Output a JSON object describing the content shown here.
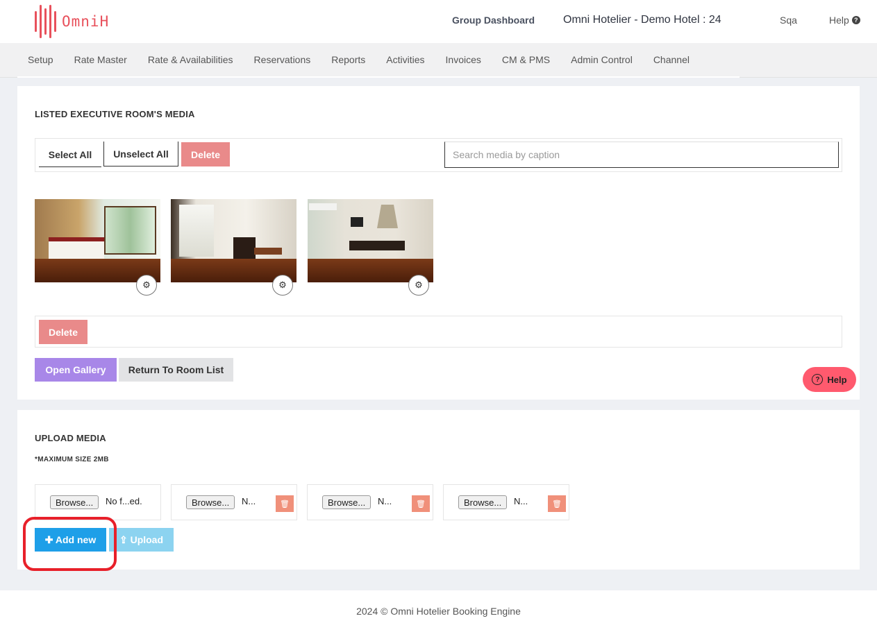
{
  "header": {
    "logo_text": "OmniH",
    "group_dashboard": "Group Dashboard",
    "hotel_name": "Omni Hotelier - Demo Hotel : 24",
    "user": "Sqa",
    "help": "Help"
  },
  "nav": {
    "items": [
      "Setup",
      "Rate Master",
      "Rate & Availabilities",
      "Reservations",
      "Reports",
      "Activities",
      "Invoices",
      "CM & PMS",
      "Admin Control",
      "Channel"
    ]
  },
  "media": {
    "title": "LISTED EXECUTIVE ROOM'S MEDIA",
    "select_all": "Select All",
    "unselect_all": "Unselect All",
    "delete": "Delete",
    "search_placeholder": "Search media by caption",
    "delete_bottom": "Delete",
    "open_gallery": "Open Gallery",
    "return_to_room_list": "Return To Room List",
    "thumbnails": [
      {
        "icon": "gear-icon"
      },
      {
        "icon": "gear-icon"
      },
      {
        "icon": "gear-icon"
      }
    ]
  },
  "help_float": {
    "label": "Help"
  },
  "upload": {
    "title": "UPLOAD MEDIA",
    "max_size": "*MAXIMUM SIZE 2MB",
    "files": [
      {
        "browse": "Browse...",
        "name": "No f...ed."
      },
      {
        "browse": "Browse...",
        "name": "N..."
      },
      {
        "browse": "Browse...",
        "name": "N..."
      },
      {
        "browse": "Browse...",
        "name": "N..."
      }
    ],
    "add_new": "Add new",
    "upload": "Upload"
  },
  "footer": {
    "text": "2024 © Omni Hotelier Booking Engine"
  },
  "colors": {
    "brand": "#e8505b",
    "delete": "#e98a8a",
    "gallery": "#a887e8",
    "add_new": "#1e9fe8",
    "upload": "#8cd3f0",
    "highlight": "#e8202a"
  }
}
